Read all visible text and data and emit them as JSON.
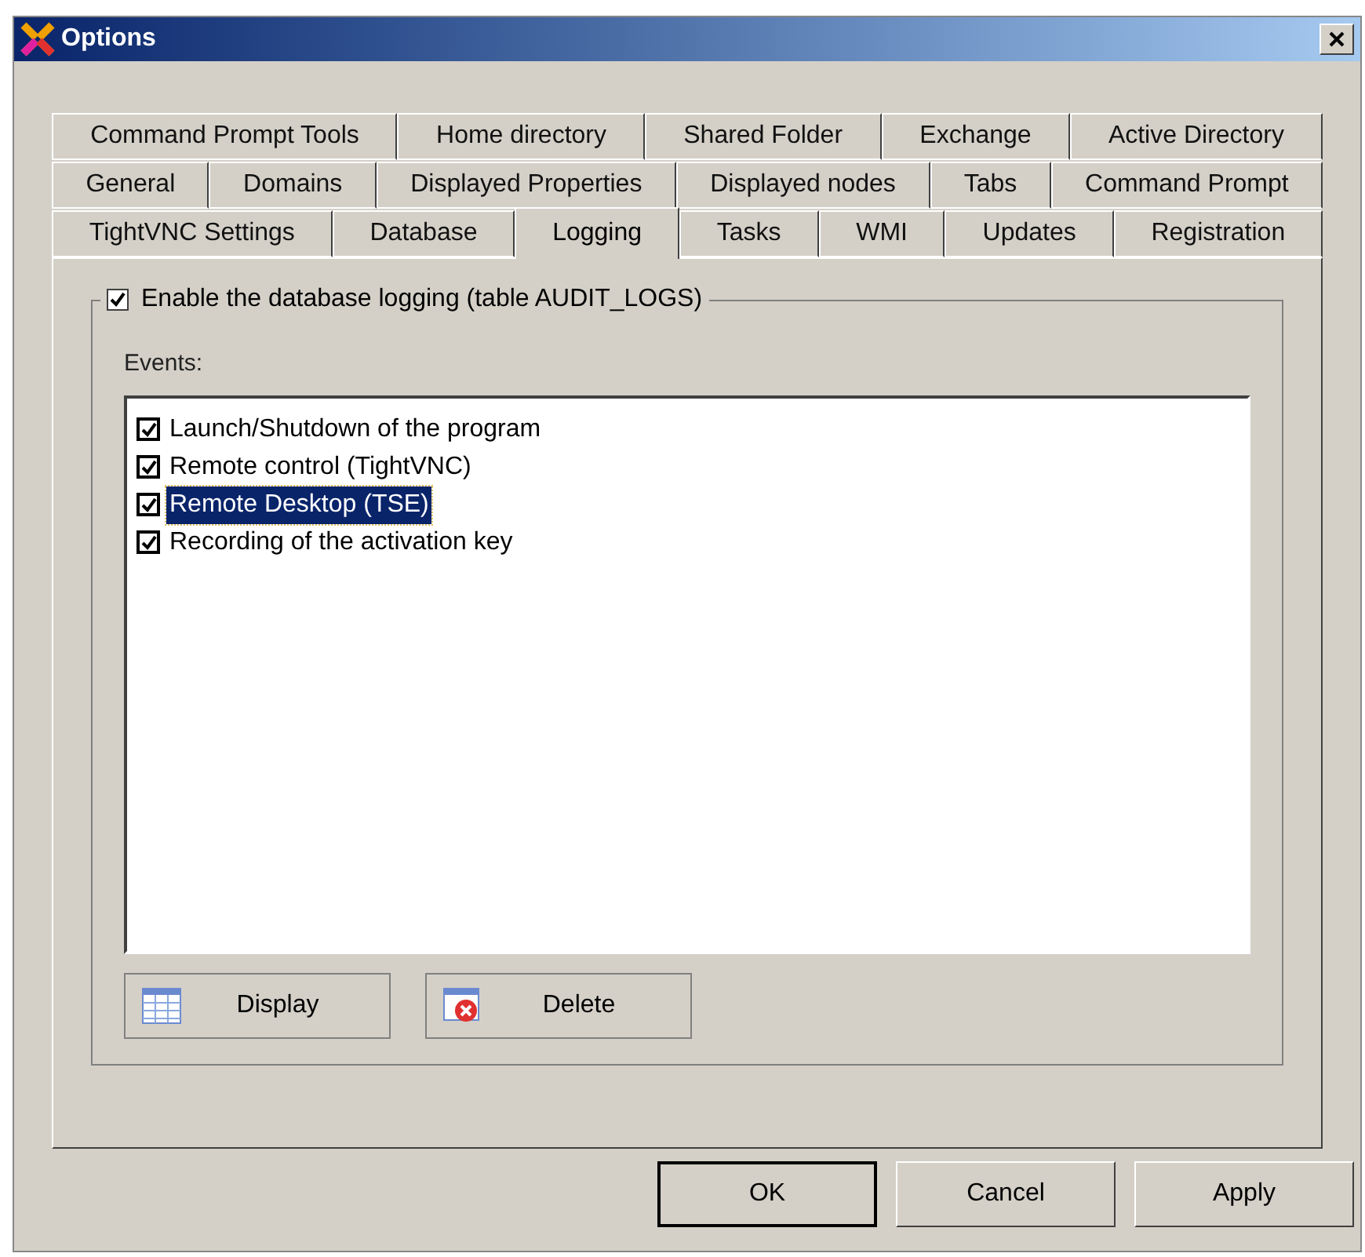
{
  "window": {
    "title": "Options"
  },
  "tab_rows": [
    [
      {
        "label": "Command Prompt Tools",
        "selected": false
      },
      {
        "label": "Home directory",
        "selected": false
      },
      {
        "label": "Shared Folder",
        "selected": false
      },
      {
        "label": "Exchange",
        "selected": false
      },
      {
        "label": "Active Directory",
        "selected": false
      }
    ],
    [
      {
        "label": "General",
        "selected": false
      },
      {
        "label": "Domains",
        "selected": false
      },
      {
        "label": "Displayed Properties",
        "selected": false
      },
      {
        "label": "Displayed nodes",
        "selected": false
      },
      {
        "label": "Tabs",
        "selected": false
      },
      {
        "label": "Command Prompt",
        "selected": false
      }
    ],
    [
      {
        "label": "TightVNC Settings",
        "selected": false
      },
      {
        "label": "Database",
        "selected": false
      },
      {
        "label": "Logging",
        "selected": true
      },
      {
        "label": "Tasks",
        "selected": false
      },
      {
        "label": "WMI",
        "selected": false
      },
      {
        "label": "Updates",
        "selected": false
      },
      {
        "label": "Registration",
        "selected": false
      }
    ]
  ],
  "group": {
    "label": "Enable the database logging (table AUDIT_LOGS)",
    "checked": true
  },
  "events_label": "Events:",
  "events": [
    {
      "label": "Launch/Shutdown of the program",
      "checked": true,
      "selected": false
    },
    {
      "label": "Remote control (TightVNC)",
      "checked": true,
      "selected": false
    },
    {
      "label": "Remote Desktop (TSE)",
      "checked": true,
      "selected": true
    },
    {
      "label": "Recording of the activation key",
      "checked": true,
      "selected": false
    }
  ],
  "log_buttons": [
    {
      "label": "Display",
      "kind": "display"
    },
    {
      "label": "Delete",
      "kind": "delete"
    }
  ],
  "buttons": [
    "OK",
    "Cancel",
    "Apply"
  ]
}
